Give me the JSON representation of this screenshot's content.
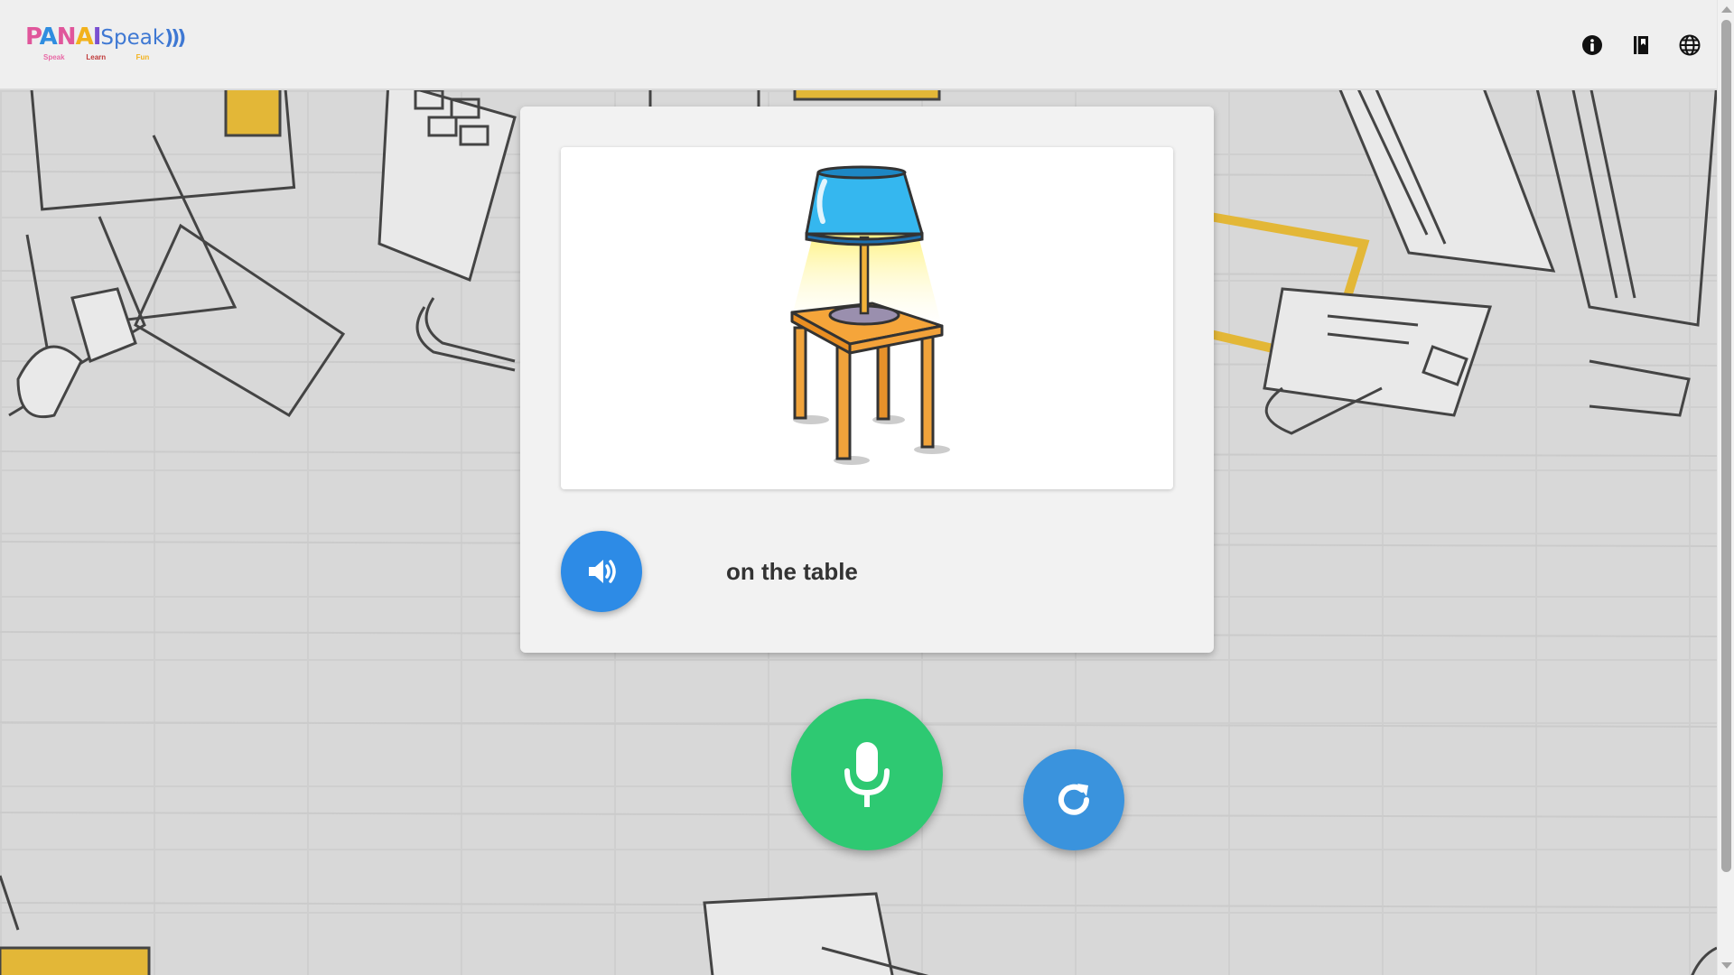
{
  "header": {
    "logo": {
      "letters": [
        "P",
        "A",
        "N",
        "A",
        "I"
      ],
      "word": "Speak",
      "waves": ")))",
      "tagline": [
        "Speak",
        "Learn",
        "Fun"
      ]
    },
    "icons": [
      "info-icon",
      "book-icon",
      "globe-icon"
    ]
  },
  "card": {
    "image_subject": "lamp on table",
    "phrase": "on the table",
    "speaker_icon": "volume-icon"
  },
  "controls": {
    "mic_icon": "microphone-icon",
    "reload_icon": "reload-icon"
  },
  "colors": {
    "header_bg": "#efefef",
    "speaker_button": "#2d8be6",
    "mic_button": "#2ec972",
    "reload_button": "#3a93dd"
  }
}
